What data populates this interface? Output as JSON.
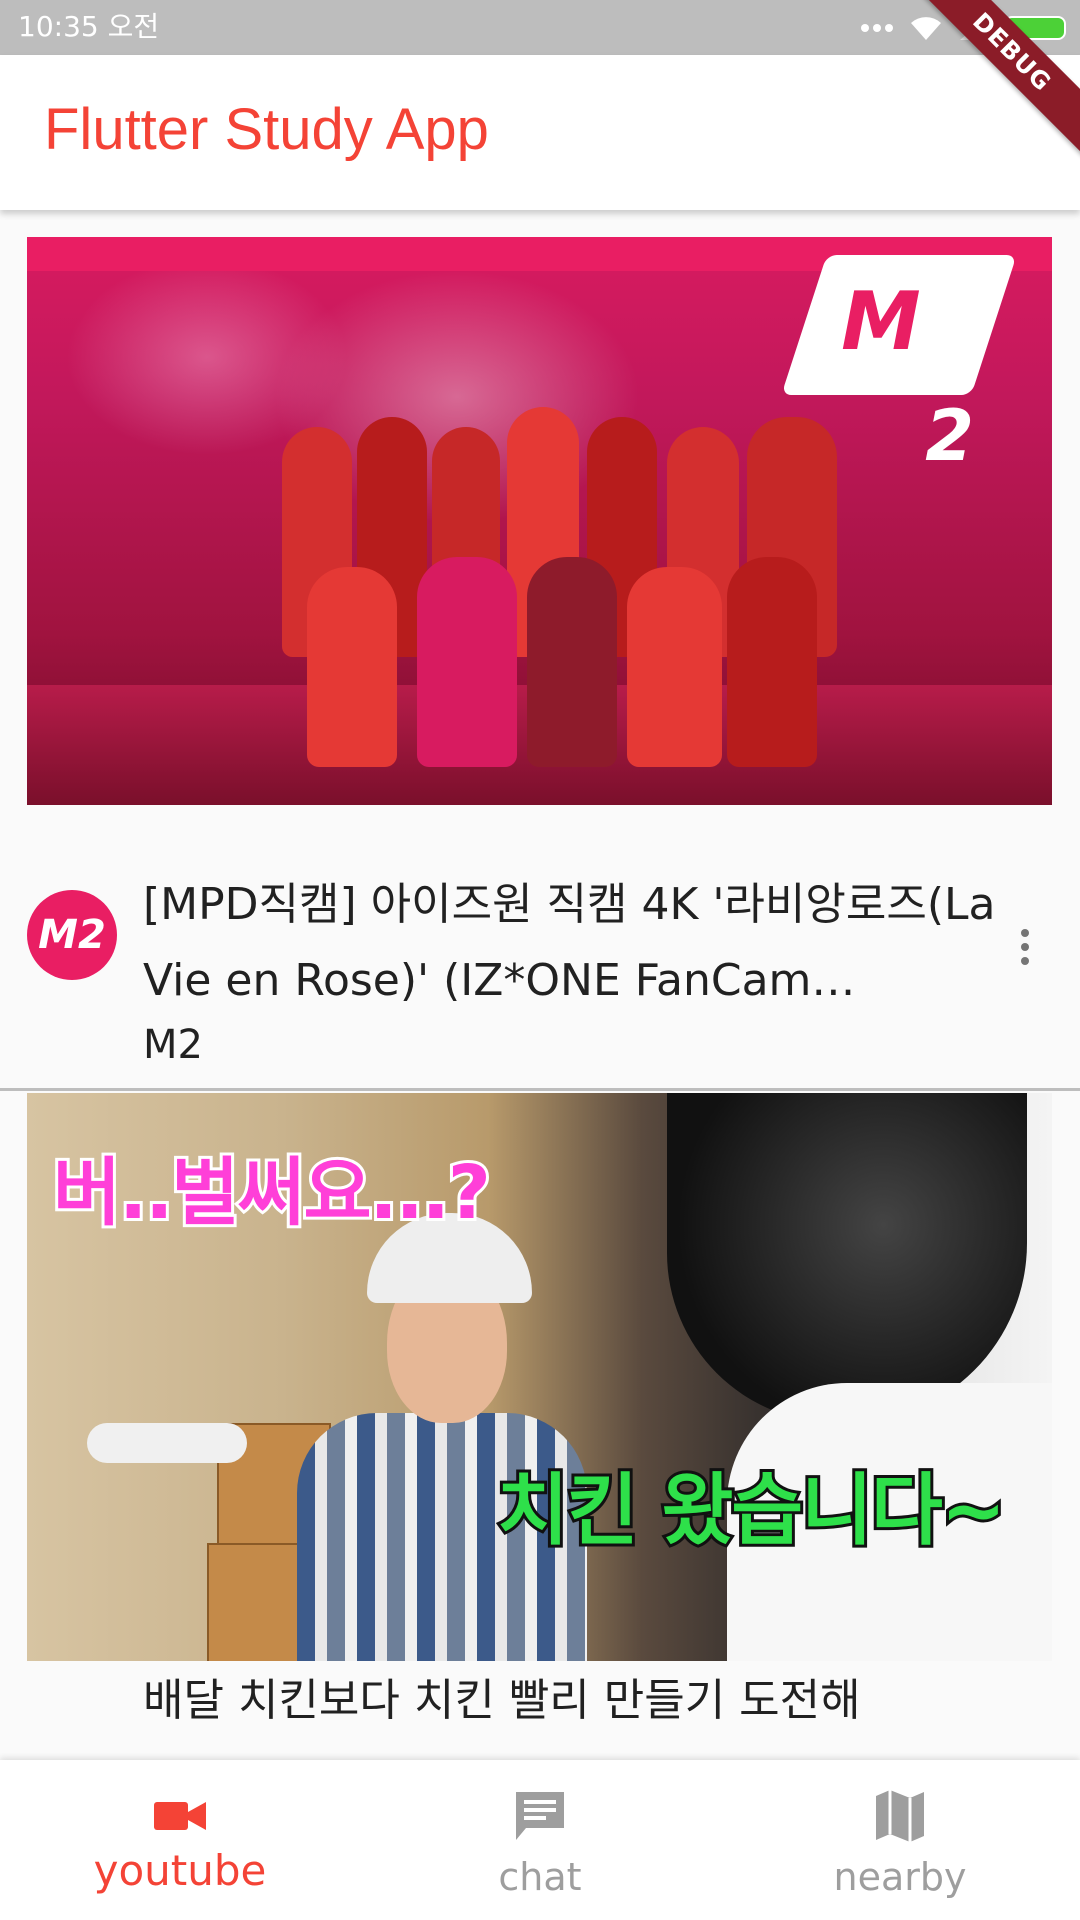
{
  "status_bar": {
    "time": "10:35 오전"
  },
  "debug_banner": "DEBUG",
  "app_bar": {
    "title": "Flutter Study App",
    "title_color": "#f44336"
  },
  "feed": {
    "videos": [
      {
        "thumbnail_icon": "stage-performance-thumbnail",
        "thumbnail_logo": "M",
        "thumbnail_logo_sub": "2",
        "title": "[MPD직캠] 아이즈원 직캠 4K '라비앙로즈(La Vie en Rose)' (IZ*ONE FanCam…",
        "channel": "M2",
        "avatar_text": "M2"
      },
      {
        "thumbnail_icon": "chicken-delivery-thumbnail",
        "thumbnail_caption_top": "버..벌써요...?",
        "thumbnail_caption_bottom": "치킨 왔습니다~",
        "title": "배달 치킨보다 치킨 빨리 만들기 도전해"
      }
    ]
  },
  "bottom_nav": {
    "items": [
      {
        "label": "youtube",
        "icon": "videocam-icon",
        "active": true
      },
      {
        "label": "chat",
        "icon": "chat-icon",
        "active": false
      },
      {
        "label": "nearby",
        "icon": "map-icon",
        "active": false
      }
    ],
    "active_color": "#f44336",
    "inactive_color": "#9e9e9e"
  }
}
